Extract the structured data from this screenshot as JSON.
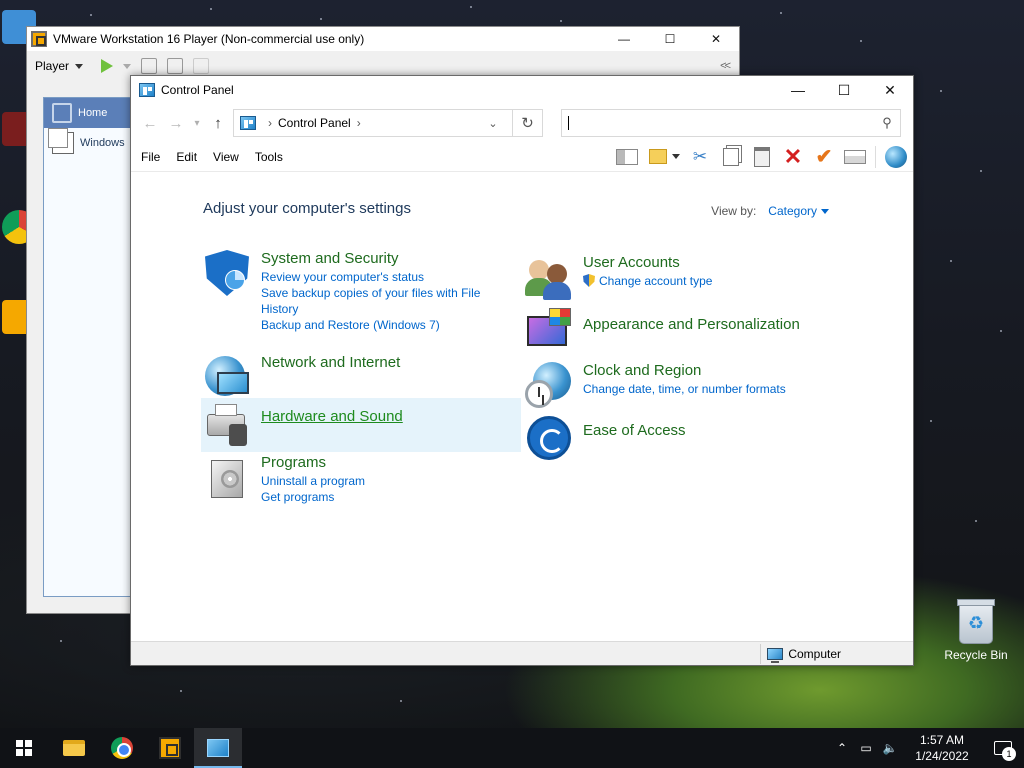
{
  "vmware": {
    "title": "VMware Workstation 16 Player (Non-commercial use only)",
    "controls": {
      "minimize": "—",
      "maximize": "☐",
      "close": "✕"
    },
    "toolbar": {
      "player_label": "Player",
      "collapse": "<<"
    },
    "library": {
      "home": "Home",
      "windows": "Windows"
    }
  },
  "control_panel": {
    "title": "Control Panel",
    "controls": {
      "minimize": "—",
      "maximize": "☐",
      "close": "✕"
    },
    "address": {
      "crumb": "Control Panel",
      "search_placeholder": ""
    },
    "menu": [
      "File",
      "Edit",
      "View",
      "Tools"
    ],
    "heading": "Adjust your computer's settings",
    "view_by": {
      "label": "View by:",
      "value": "Category"
    },
    "categories_left": [
      {
        "title": "System and Security",
        "links": [
          "Review your computer's status",
          "Save backup copies of your files with File History",
          "Backup and Restore (Windows 7)"
        ]
      },
      {
        "title": "Network and Internet",
        "links": []
      },
      {
        "title": "Hardware and Sound",
        "links": []
      },
      {
        "title": "Programs",
        "links": [
          "Uninstall a program",
          "Get programs"
        ]
      }
    ],
    "categories_right": [
      {
        "title": "User Accounts",
        "links": [
          "Change account type"
        ]
      },
      {
        "title": "Appearance and Personalization",
        "links": []
      },
      {
        "title": "Clock and Region",
        "links": [
          "Change date, time, or number formats"
        ]
      },
      {
        "title": "Ease of Access",
        "links": []
      }
    ],
    "status": {
      "computer": "Computer"
    }
  },
  "desktop": {
    "recycle_bin": "Recycle Bin"
  },
  "taskbar": {
    "time": "1:57 AM",
    "date": "1/24/2022",
    "notification_count": "1"
  }
}
